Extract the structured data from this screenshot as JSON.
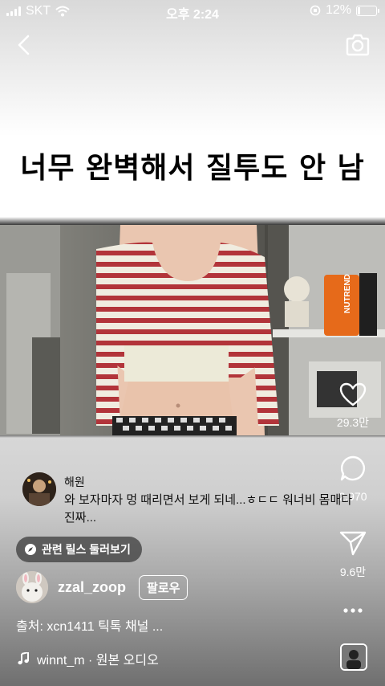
{
  "status_bar": {
    "carrier": "SKT",
    "time": "오후 2:24",
    "battery": "12%",
    "battery_level": 0.12
  },
  "icons": {
    "back": "chevron-left-icon",
    "camera": "camera-icon",
    "like": "heart-icon",
    "comment": "comment-icon",
    "share": "send-icon",
    "more": "more-icon",
    "music": "music-note-icon",
    "reels": "compass-icon"
  },
  "caption": "너무 완벽해서 질투도 안 남",
  "actions": {
    "likes": "29.3만",
    "comments": "2,970",
    "shares": "9.6만"
  },
  "top_comment": {
    "author": "해원",
    "text": "와 보자마자 멍 때리면서 보게 되네...ㅎㄷㄷ 워너비 몸매다 진짜..."
  },
  "related_reels": "관련 릴스 둘러보기",
  "user": {
    "username": "zzal_zoop",
    "follow_label": "팔로우"
  },
  "source": "출처: xcn1411 틱톡 채널 ...",
  "audio": "winnt_m · 원본 오디오",
  "colors": {
    "stripe": "#b2343a",
    "sweater": "#f0ece0"
  }
}
